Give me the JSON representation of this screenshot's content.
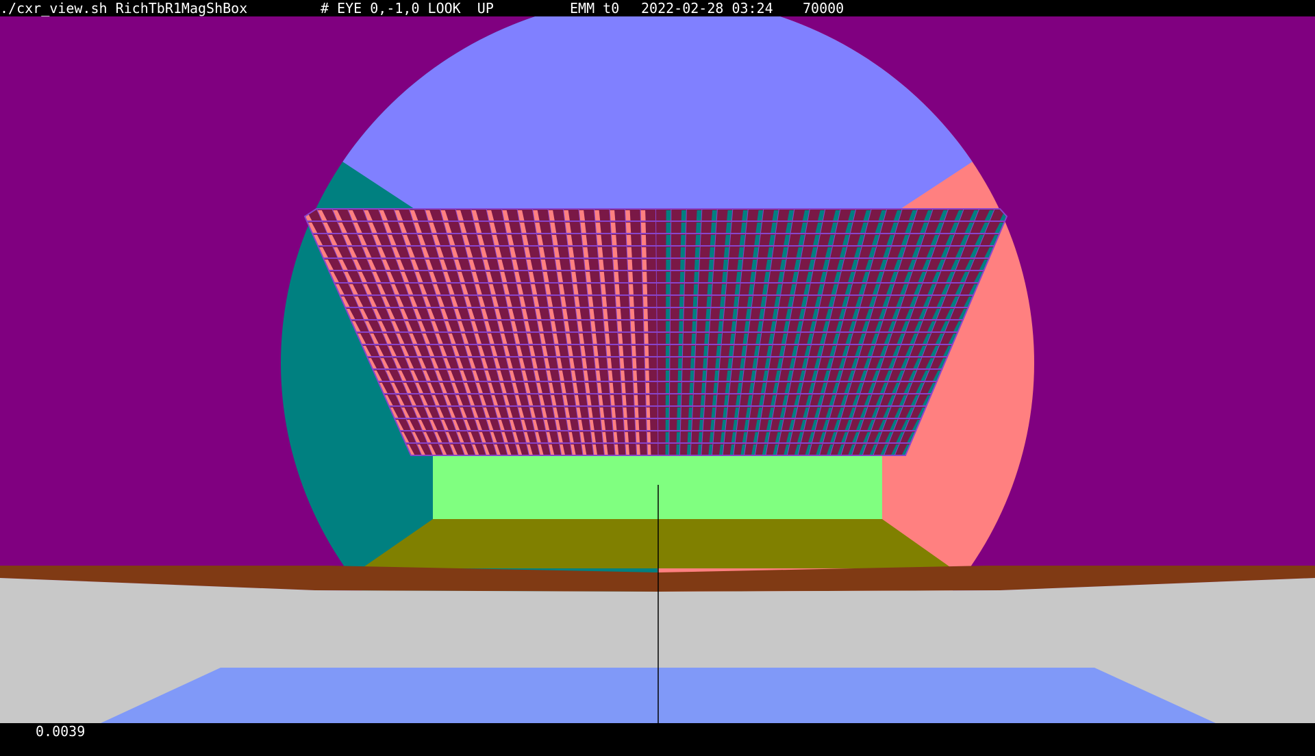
{
  "header": {
    "command": "./cxr_view.sh RichTbR1MagShBox",
    "eye": "# EYE 0,-1,0 LOOK  UP",
    "emm": "EMM t0",
    "datetime": "2022-02-28 03:24",
    "count": "70000"
  },
  "footer": {
    "value": "0.0039"
  },
  "scene": {
    "colors": {
      "background": "#800080",
      "disc_top": "#8080ff",
      "disc_left": "#008080",
      "disc_right": "#ff8080",
      "grid_base": "#7a1846",
      "grid_line": "#8844cc",
      "box_face": "#80ff80",
      "box_floor": "#808000",
      "rim": "#803a14",
      "floor": "#c8c8c8",
      "floor_panel": "#8099f8",
      "axis_line": "#000000"
    }
  }
}
